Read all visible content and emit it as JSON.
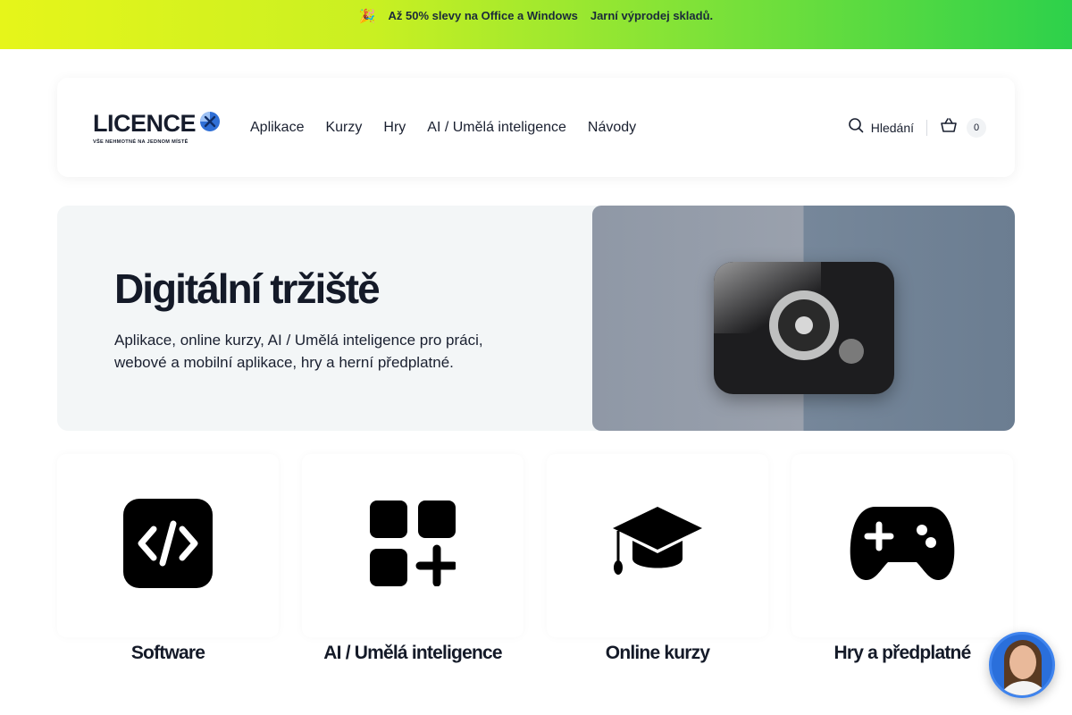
{
  "promo": {
    "emoji": "🎉",
    "sale_text": "Až 50% slevy na Office a Windows",
    "sub_text": "Jarní výprodej skladů."
  },
  "header": {
    "logo_word": "LICENCE",
    "logo_tagline": "VŠE NEHMOTNÉ NA JEDNOM MÍSTĚ",
    "nav": [
      {
        "label": "Aplikace"
      },
      {
        "label": "Kurzy"
      },
      {
        "label": "Hry"
      },
      {
        "label": "AI / Umělá inteligence"
      },
      {
        "label": "Návody"
      }
    ],
    "search_label": "Hledání",
    "cart_count": "0"
  },
  "hero": {
    "title": "Digitální tržiště",
    "text": "Aplikace, online kurzy, AI / Umělá inteligence pro práci, webové a mobilní aplikace, hry a herní předplatné."
  },
  "categories": [
    {
      "label": "Software",
      "icon": "code-icon"
    },
    {
      "label": "AI / Umělá inteligence",
      "icon": "apps-plus-icon"
    },
    {
      "label": "Online kurzy",
      "icon": "graduation-cap-icon"
    },
    {
      "label": "Hry a předplatné",
      "icon": "gamepad-icon"
    }
  ],
  "colors": {
    "promo_gradient_start": "#e6f51a",
    "promo_gradient_end": "#2dd14b",
    "text_dark": "#141a28",
    "hero_bg": "#f3f6f7",
    "chat_accent": "#2a6fdb"
  }
}
